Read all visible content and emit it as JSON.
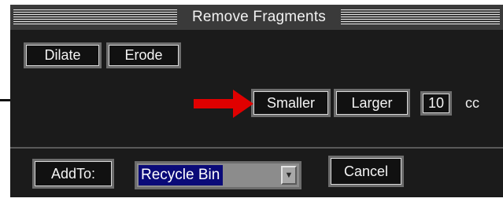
{
  "window": {
    "title": "Remove Fragments"
  },
  "row1": {
    "dilate_label": "Dilate",
    "erode_label": "Erode"
  },
  "row2": {
    "smaller_label": "Smaller",
    "larger_label": "Larger",
    "size_value": "10",
    "size_unit": "cc",
    "arrow_color": "#e00000"
  },
  "row3": {
    "addto_label": "AddTo:",
    "bin_selected": "Recycle Bin",
    "cancel_label": "Cancel"
  },
  "icons": {
    "dropdown_arrow": "chevron-down-icon",
    "annotation_arrow": "red-arrow-icon"
  },
  "colors": {
    "panel_background": "#1b1b1b",
    "titlebar_background": "#3a3a3a",
    "selection_highlight": "#0a0a78"
  }
}
